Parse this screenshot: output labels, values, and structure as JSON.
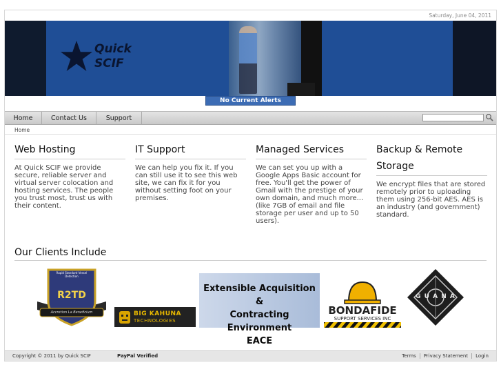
{
  "date": "Saturday, June 04, 2011",
  "logo": {
    "line1": "Quick",
    "line2": "SCIF",
    "icon": "star-icon"
  },
  "alerts": "No Current Alerts",
  "nav": {
    "items": [
      {
        "label": "Home"
      },
      {
        "label": "Contact Us"
      },
      {
        "label": "Support"
      }
    ],
    "search_placeholder": "",
    "search_icon": "magnifier-icon"
  },
  "breadcrumb": "Home",
  "sections": [
    {
      "title": "Web Hosting",
      "body": "At Quick SCIF we provide secure, reliable server and virtual server colocation and hosting services. The people you trust most, trust us with their content."
    },
    {
      "title": "IT Support",
      "body": "We can help you fix it. If you can still use it to see this web site, we can fix it for you without setting foot on your premises."
    },
    {
      "title": "Managed Services",
      "body": "We can set you up with a Google Apps Basic account for free. You'll get the power of Gmail with the prestige of your own domain, and much more... (like 7GB of email and file storage per user and up to 50 users)."
    },
    {
      "title": "Backup & Remote Storage",
      "body": "We encrypt files that are stored remotely prior to uploading them using 256-bit AES. AES is an industry (and government) standard."
    }
  ],
  "clients": {
    "title": "Our Clients Include",
    "r2td": {
      "top": "Rapid Standard Vessel Detection",
      "name": "R2TD",
      "motto": "Accretion La Beneficium"
    },
    "bigkahuna": {
      "line1": "BIG KAHUNA",
      "line2": "TECHNOLOGIES"
    },
    "eace": {
      "line1": "Extensible Acquisition &",
      "line2": "Contracting Environment",
      "line3": "EACE"
    },
    "bondafide": {
      "name": "BONDAFIDE",
      "sub": "SUPPORT SERVICES INC"
    },
    "guana": {
      "letters": "G U A N A"
    }
  },
  "footer": {
    "copyright": "Copyright © 2011 by Quick SCIF",
    "paypal": "PayPal Verified",
    "links": [
      "Terms",
      "Privacy Statement",
      "Login"
    ]
  }
}
